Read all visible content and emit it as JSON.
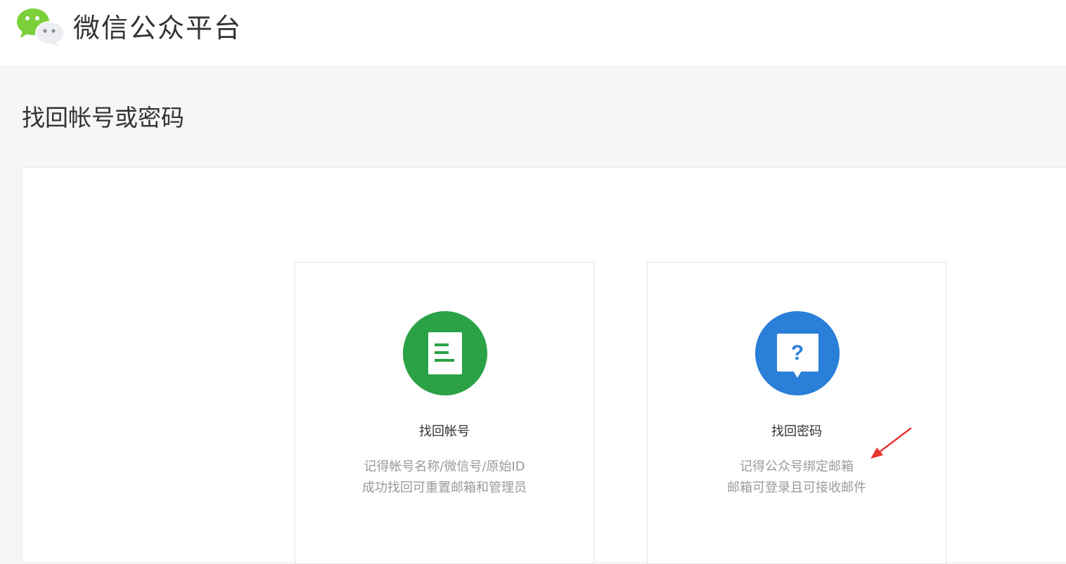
{
  "header": {
    "logo_icon": "wechat-logo-icon",
    "app_title": "微信公众平台"
  },
  "page": {
    "title": "找回帐号或密码"
  },
  "options": [
    {
      "icon": "document-list-icon",
      "icon_color": "#2ba246",
      "title": "找回帐号",
      "desc_line1": "记得帐号名称/微信号/原始ID",
      "desc_line2": "成功找回可重置邮箱和管理员"
    },
    {
      "icon": "question-bubble-icon",
      "icon_color": "#2a7fd8",
      "title": "找回密码",
      "desc_line1": "记得公众号绑定邮箱",
      "desc_line2": "邮箱可登录且可接收邮件"
    }
  ],
  "annotation": {
    "icon": "red-arrow-icon",
    "color": "#e8352f"
  }
}
